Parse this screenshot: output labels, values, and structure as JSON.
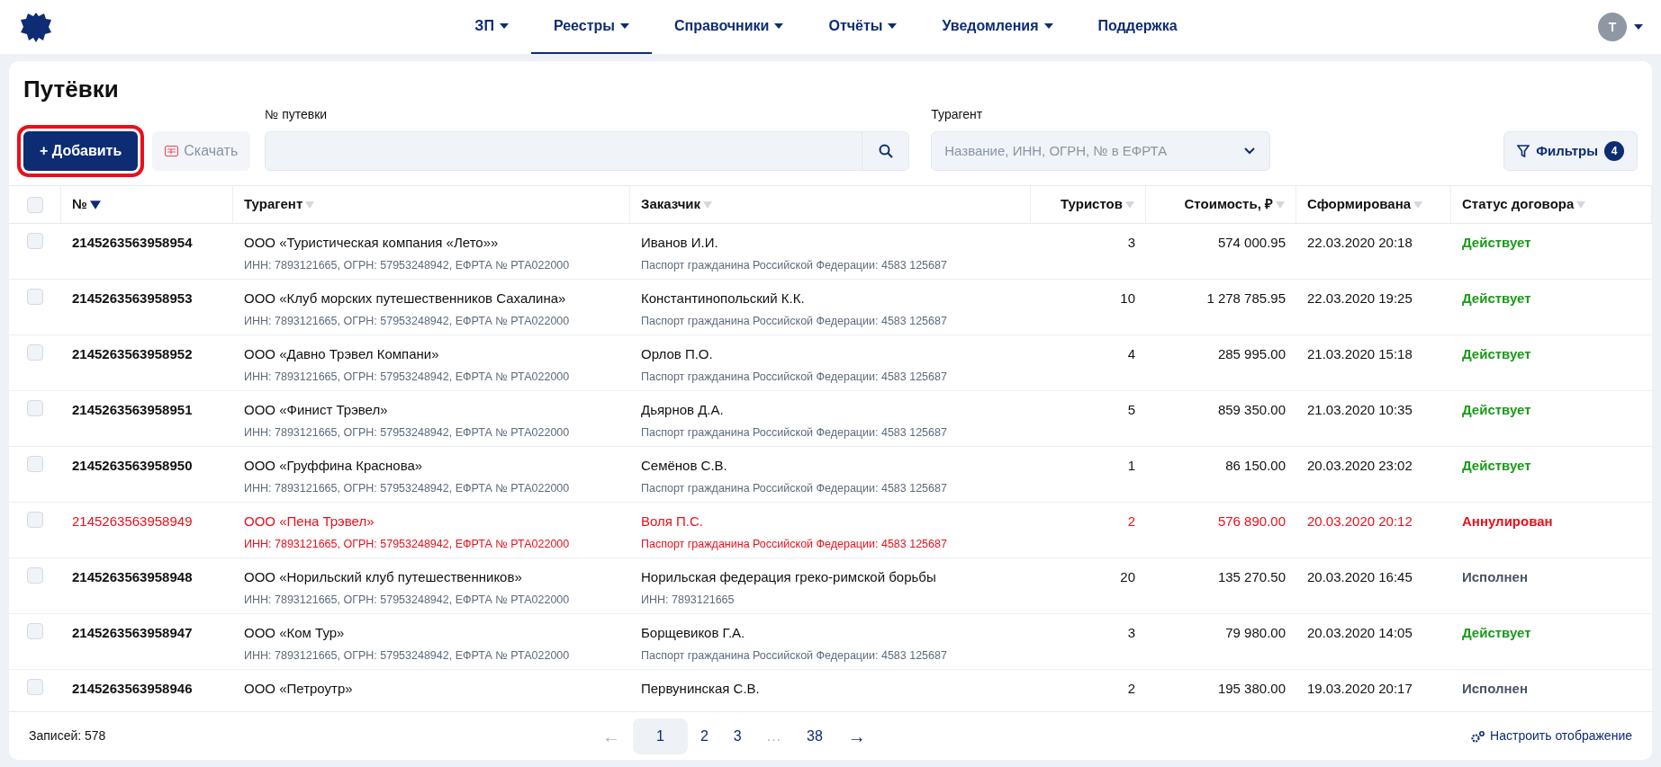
{
  "nav": {
    "items": [
      {
        "label": "ЗП",
        "dropdown": true,
        "selected": false
      },
      {
        "label": "Реестры",
        "dropdown": true,
        "selected": true
      },
      {
        "label": "Справочники",
        "dropdown": true,
        "selected": false
      },
      {
        "label": "Отчёты",
        "dropdown": true,
        "selected": false
      },
      {
        "label": "Уведомления",
        "dropdown": true,
        "selected": false
      },
      {
        "label": "Поддержка",
        "dropdown": false,
        "selected": false
      }
    ],
    "user_initial": "Т"
  },
  "page": {
    "title": "Путёвки"
  },
  "toolbar": {
    "add_button": {
      "label": "+ Добавить",
      "highlighted": true
    },
    "download_button": {
      "label": "Скачать",
      "disabled": true
    },
    "number_field": {
      "label": "№ путевки"
    },
    "agent_field": {
      "label": "Турагент",
      "placeholder": "Название, ИНН, ОГРН, № в ЕФРТА"
    },
    "filters_button": {
      "label": "Фильтры",
      "count": "4"
    }
  },
  "table": {
    "select_all": {
      "checked": false
    },
    "columns": [
      {
        "label": "№",
        "kind": "text",
        "sort_active": true
      },
      {
        "label": "Турагент",
        "kind": "text",
        "sort_active": false
      },
      {
        "label": "Заказчик",
        "kind": "text",
        "sort_active": false
      },
      {
        "label": "Туристов",
        "kind": "number",
        "sort_active": false
      },
      {
        "label": "Стоимость, ₽",
        "kind": "number",
        "sort_active": false
      },
      {
        "label": "Сформирована",
        "kind": "text",
        "sort_active": false
      },
      {
        "label": "Статус договора",
        "kind": "text",
        "sort_active": false
      }
    ],
    "rows": [
      {
        "checked": false,
        "cancelled": false,
        "number": "2145263563958954",
        "agent": "ООО «Туристическая компания «Лето»»",
        "agent_details": "ИНН: 7893121665, ОГРН: 57953248942, ЕФРТА № РТА022000",
        "customer": "Иванов И.И.",
        "customer_details": "Паспорт гражданина Российской Федерации: 4583 125687",
        "tourists": "3",
        "cost": "574 000.95",
        "created": "22.03.2020 20:18",
        "status": "Действует",
        "color": "#1a9a1a"
      },
      {
        "checked": false,
        "cancelled": false,
        "number": "2145263563958953",
        "agent": "ООО «Клуб морских путешественников Сахалина»",
        "agent_details": "ИНН: 7893121665, ОГРН: 57953248942, ЕФРТА № РТА022000",
        "customer": "Константинопольский К.К.",
        "customer_details": "Паспорт гражданина Российской Федерации: 4583 125687",
        "tourists": "10",
        "cost": "1 278 785.95",
        "created": "22.03.2020 19:25",
        "status": "Действует",
        "color": "#1a9a1a"
      },
      {
        "checked": false,
        "cancelled": false,
        "number": "2145263563958952",
        "agent": "ООО «Давно Трэвел Компани»",
        "agent_details": "ИНН: 7893121665, ОГРН: 57953248942, ЕФРТА № РТА022000",
        "customer": "Орлов П.О.",
        "customer_details": "Паспорт гражданина Российской Федерации: 4583 125687",
        "tourists": "4",
        "cost": "285 995.00",
        "created": "21.03.2020 15:18",
        "status": "Действует",
        "color": "#1a9a1a"
      },
      {
        "checked": false,
        "cancelled": false,
        "number": "2145263563958951",
        "agent": "ООО «Финист Трэвел»",
        "agent_details": "ИНН: 7893121665, ОГРН: 57953248942, ЕФРТА № РТА022000",
        "customer": "Дьярнов Д.А.",
        "customer_details": "Паспорт гражданина Российской Федерации: 4583 125687",
        "tourists": "5",
        "cost": "859 350.00",
        "created": "21.03.2020 10:35",
        "status": "Действует",
        "color": "#1a9a1a"
      },
      {
        "checked": false,
        "cancelled": false,
        "number": "2145263563958950",
        "agent": "ООО «Груффина Краснова»",
        "agent_details": "ИНН: 7893121665, ОГРН: 57953248942, ЕФРТА № РТА022000",
        "customer": "Семёнов С.В.",
        "customer_details": "Паспорт гражданина Российской Федерации: 4583 125687",
        "tourists": "1",
        "cost": "86 150.00",
        "created": "20.03.2020 23:02",
        "status": "Действует",
        "color": "#1a9a1a"
      },
      {
        "checked": false,
        "cancelled": true,
        "number": "2145263563958949",
        "agent": "ООО «Пена Трэвел»",
        "agent_details": "ИНН: 7893121665, ОГРН: 57953248942, ЕФРТА № РТА022000",
        "customer": "Воля П.С.",
        "customer_details": "Паспорт гражданина Российской Федерации: 4583 125687",
        "tourists": "2",
        "cost": "576 890.00",
        "created": "20.03.2020 20:12",
        "status": "Аннулирован",
        "color": "#e8101c"
      },
      {
        "checked": false,
        "cancelled": false,
        "number": "2145263563958948",
        "agent": "ООО «Норильский клуб путешественников»",
        "agent_details": "ИНН: 7893121665, ОГРН: 57953248942, ЕФРТА № РТА022000",
        "customer": "Норильская федерация греко-римской борьбы",
        "customer_details": "ИНН: 7893121665",
        "tourists": "20",
        "cost": "135 270.50",
        "created": "20.03.2020 16:45",
        "status": "Исполнен",
        "color": "#4b5563"
      },
      {
        "checked": false,
        "cancelled": false,
        "number": "2145263563958947",
        "agent": "ООО «Ком  Тур»",
        "agent_details": "ИНН: 7893121665, ОГРН: 57953248942, ЕФРТА № РТА022000",
        "customer": "Борщевиков Г.А.",
        "customer_details": "Паспорт гражданина Российской Федерации: 4583 125687",
        "tourists": "3",
        "cost": "79 980.00",
        "created": "20.03.2020 14:05",
        "status": "Действует",
        "color": "#1a9a1a"
      },
      {
        "checked": false,
        "cancelled": false,
        "number": "2145263563958946",
        "agent": "ООО «Петроутр»",
        "customer": "Первунинская С.В.",
        "tourists": "2",
        "cost": "195 380.00",
        "created": "19.03.2020 20:17",
        "status": "Исполнен",
        "color": "#4b5563"
      }
    ]
  },
  "footer": {
    "records": "Записей: 578",
    "pagination": [
      {
        "label": "←",
        "kind": "arrow",
        "disabled": true,
        "selected": false
      },
      {
        "label": "1",
        "kind": "page",
        "disabled": false,
        "selected": true
      },
      {
        "label": "2",
        "kind": "page",
        "disabled": false,
        "selected": false
      },
      {
        "label": "3",
        "kind": "page",
        "disabled": false,
        "selected": false
      },
      {
        "label": "...",
        "kind": "gap",
        "disabled": true,
        "selected": false
      },
      {
        "label": "38",
        "kind": "page",
        "disabled": false,
        "selected": false
      },
      {
        "label": "→",
        "kind": "arrow",
        "disabled": false,
        "selected": false
      }
    ],
    "settings_link": "Настроить отображение"
  }
}
